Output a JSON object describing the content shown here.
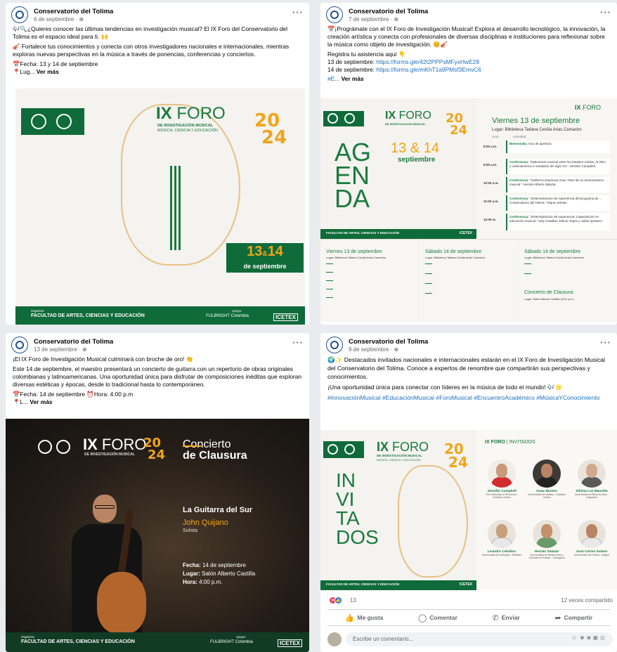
{
  "page": {
    "name": "Conservatorio del Tolima"
  },
  "posts": [
    {
      "date": "6 de septiembre · ",
      "lines": [
        "🎶🔍¿Quieres conocer las últimas tendencias en investigación musical? El IX Foro del Conservatorio del Tolima es el espacio ideal para ti. 🙌",
        "🎻 Fortalece tus conocimientos y conecta con otros investigadores nacionales e internacionales, mientras exploras nuevas perspectivas en la música a través de ponencias, conferencias y conciertos.",
        "📅Fecha: 13 y 14 de septiembre",
        "📍Lug... "
      ],
      "more": "Ver más"
    },
    {
      "date": "7 de septiembre · ",
      "lines": [
        "📅¡Prográmate con el IX Foro de Investigación Musical! Explora el desarrollo tecnológico, la innovación, la creación artística y conecta con profesionales de diversas disciplinas e instituciones para reflexionar sobre la música como objeto de investigación. 😊🎻",
        "Registra tu asistencia aquí 👇",
        "13 de septiembre: ",
        "14 de septiembre: ",
        "#E... "
      ],
      "links": [
        "https://forms.gle/42t2PPPsMFyxHwE28",
        "https://forms.gle/mKhT1a9PMsf3EmvC6"
      ],
      "more": "Ver más"
    },
    {
      "date": "13 de septiembre · ",
      "lines": [
        "¡El IX Foro de Investigación Musical culminará con broche de oro! 👏",
        "Este 14 de septiembre, el maestro presentará un concierto de guitarra con un repertorio de obras originales colombianas y latinoamericanas. Una oportunidad única para disfrutar de composiciones inéditas que exploran diversas estéticas y épocas, desde lo tradicional hasta lo contemporáneo.",
        "📅Fecha: 14 de septiembre ⏰Hora: 4:00 p.m",
        "📍L... "
      ],
      "more": "Ver más"
    },
    {
      "date": "9 de septiembre · ",
      "lines": [
        "🌍✨ Destacados invitados nacionales e internacionales estarán en el IX Foro de Investigación Musical del Conservatorio del Tolima. Conoce a expertos de renombre que compartirán sus perspectivas y conocimientos.",
        "¡Una oportunidad única para conectar con líderes en la música de todo el mundo! 🎶🌟",
        "#InnovaciónMusical #EducaciónMusical #ForoMusical #EncuentroAcadémico #MúsicaYConocimiento"
      ],
      "reactions": "13",
      "shares": "12 veces compartido",
      "actions": [
        "Me gusta",
        "Comentar",
        "Enviar",
        "Compartir"
      ],
      "comment_placeholder": "Escribe un comentario..."
    }
  ],
  "forum": {
    "ix": "IX",
    "foro": "FORO",
    "sub1": "DE INVESTIGACIÓN MUSICAL",
    "sub2": "MÚSICA, CIENCIA Y EDUCACIÓN",
    "year_a": "20",
    "year_b": "24",
    "date_13": "13",
    "amp": "&",
    "date_14": "14",
    "de_sep": "de septiembre",
    "organiza": "Organiza:",
    "facultad": "FACULTAD DE ARTES, CIENCIAS Y EDUCACIÓN",
    "conserv": "CONSERVATORIO DEL TOLIMA",
    "apoya": "Apoya:",
    "fulbright": "FULBRIGHT Colombia",
    "icetex": "ICETEX"
  },
  "agenda": {
    "word": [
      "AG",
      "EN",
      "DA"
    ],
    "dates": "13 & 14",
    "month": "septiembre",
    "day1": "Viernes 13 de septiembre",
    "lugar": "Lugar: Biblioteca Tatiana Cecilia Arias Camacho",
    "hora": "Hora",
    "actividad": "Actividad",
    "items": [
      {
        "h": "8:00 a.m.",
        "t": "Bienvenida.",
        "d": "Acto de apertura."
      },
      {
        "h": "9:00 a.m.",
        "t": "Conferencia:",
        "d": "\"Diplomacia musical entre los Estados Unidos, la OEA y Latinoamérica a mediados del siglo XX.\" Jennifer Campbell."
      },
      {
        "h": "10:00 a.m.",
        "t": "Conferencia:",
        "d": "\"Guillermo Espinosa Grau: hitos de un americanismo musical.\" Hernán Alberto Salazar."
      },
      {
        "h": "11:00 a.m.",
        "t": "Conferencia:",
        "d": "\"Sistematización de experiencia del programa de ... Conservatorio del Tolima.\" Diana Arévalo."
      },
      {
        "h": "12:00 m.",
        "t": "Conferencia:",
        "d": "\"Sistematización de experiencia: Capacitación en educación musical.\" Zuly Casallas, Edson Yepes y Julián Quintero."
      }
    ],
    "mini": [
      {
        "head": "Viernes 13 de septiembre",
        "lugar": "Lugar: Biblioteca Tatiana Cecilia Arias Camacho"
      },
      {
        "head": "Sábado 14 de septiembre",
        "lugar": "Lugar: Biblioteca Tatiana Cecilia Arias Camacho"
      },
      {
        "head": "Sábado 14 de septiembre",
        "lugar": "Lugar: Biblioteca Tatiana Cecilia Arias Camacho",
        "closing": "Concierto de Clausura",
        "closing_lugar": "Lugar: Salón Alberto Castilla (4:00 p.m.)"
      }
    ]
  },
  "concert": {
    "title1": "Concierto",
    "title2": "de Clausura",
    "piece": "La Guitarra del Sur",
    "artist": "John Quijano",
    "role": "Solista",
    "fecha_l": "Fecha:",
    "fecha_v": "14 de septiembre",
    "lugar_l": "Lugar:",
    "lugar_v": "Salón Alberto Castilla",
    "hora_l": "Hora:",
    "hora_v": "4:00 p.m."
  },
  "guests": {
    "word": [
      "IN",
      "VI",
      "TA",
      "DOS"
    ],
    "label": "INVITADOS",
    "people": [
      {
        "name": "Jennifer Campbell",
        "inst": "The University of Richmond - Estados Unidos"
      },
      {
        "name": "Isaac Bustos",
        "inst": "Universidad de Indiana - Estados Unidos"
      },
      {
        "name": "Silvina Luz Mansilla",
        "inst": "Universidad de Buenos Aires - Argentina"
      },
      {
        "name": "Leandro Ceballos",
        "inst": "Universidad de Antioquia - Medellín"
      },
      {
        "name": "Hernán Salazar",
        "inst": "Universidad de Bellas Artes y Ciencias de Bolívar - Cartagena"
      },
      {
        "name": "Juan Carlos Solano",
        "inst": "Universidad del Tolima - Ibagué"
      }
    ]
  }
}
